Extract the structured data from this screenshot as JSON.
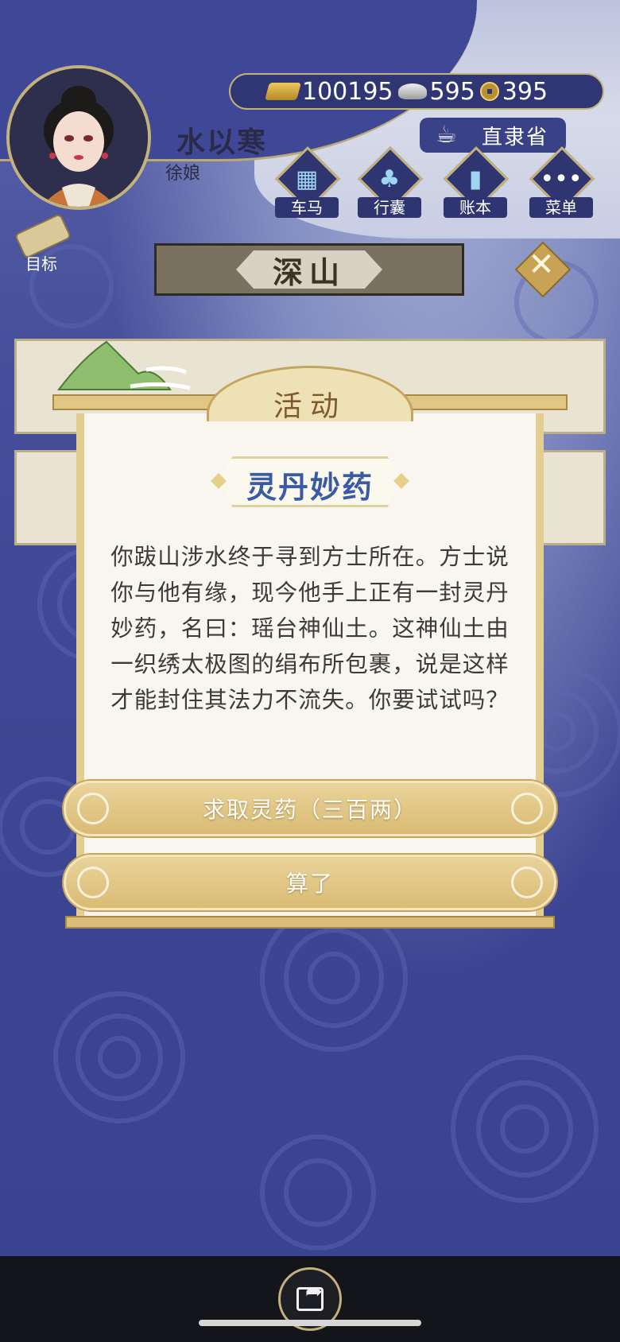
{
  "player": {
    "name": "水以寒",
    "rank": "徐娘"
  },
  "currency": {
    "gold": "100195",
    "silver": "595",
    "coins": "395"
  },
  "location": "直隶省",
  "menu": [
    {
      "label": "车马",
      "icon": "carriage-icon"
    },
    {
      "label": "行囊",
      "icon": "bag-icon"
    },
    {
      "label": "账本",
      "icon": "ledger-icon"
    },
    {
      "label": "菜单",
      "icon": "menu-dots-icon"
    }
  ],
  "goal_label": "目标",
  "area_name": "深山",
  "dialog": {
    "header": "活动",
    "event_title": "灵丹妙药",
    "text": "你跋山涉水终于寻到方士所在。方士说你与他有缘，现今他手上正有一封灵丹妙药，名曰：瑶台神仙土。这神仙土由一织绣太极图的绢布所包裹，说是这样才能封住其法力不流失。你要试试吗？",
    "choices": [
      "求取灵药（三百两）",
      "算了"
    ]
  },
  "colors": {
    "bg": "#3c4590",
    "gold_trim": "#c4b27c",
    "title_blue": "#3a5aa3",
    "button_gold": "#ddbf78"
  }
}
